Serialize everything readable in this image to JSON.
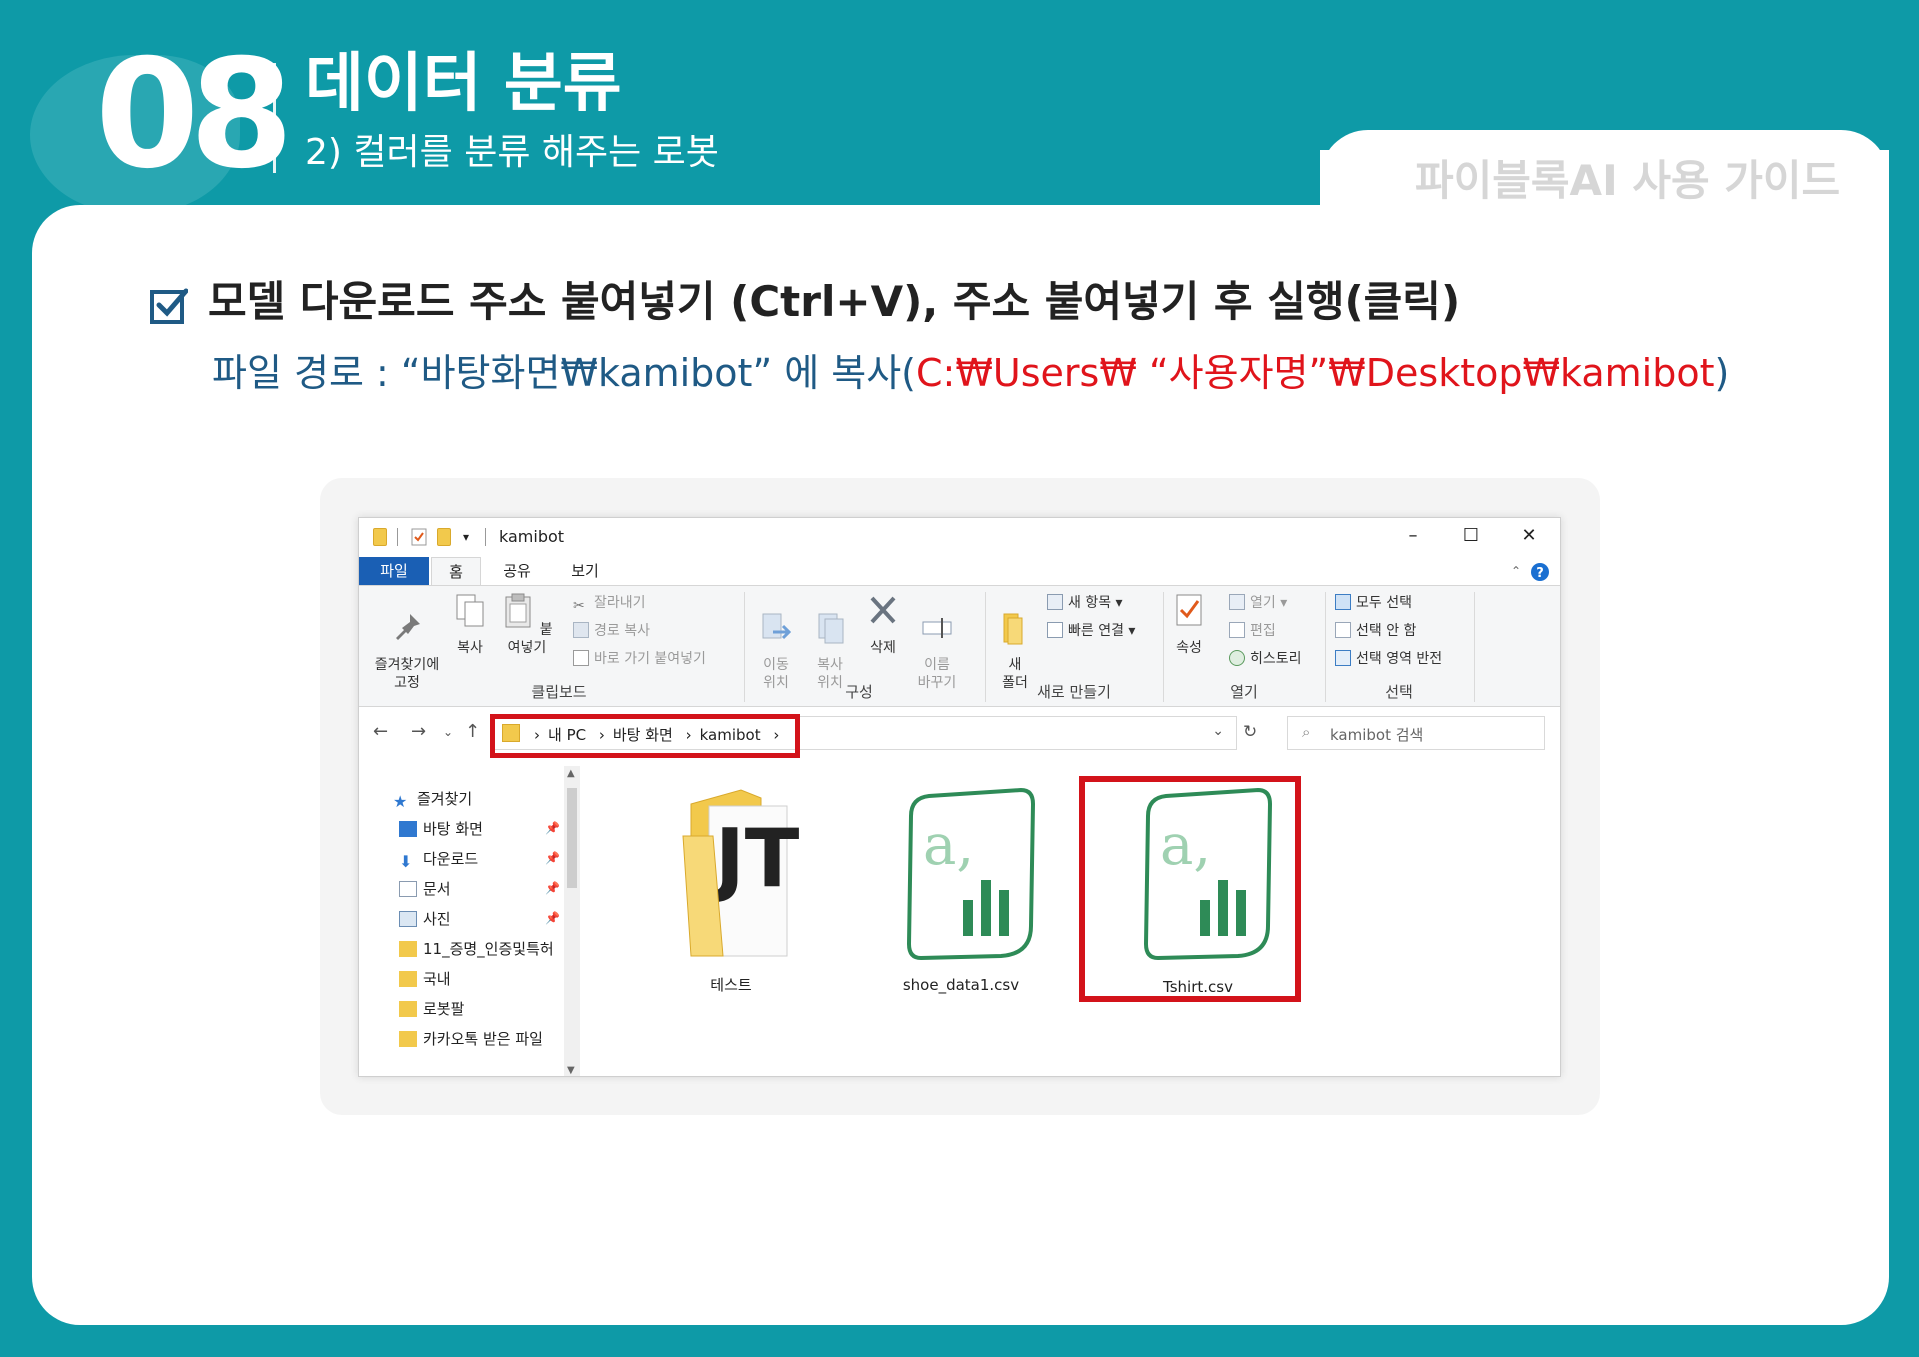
{
  "header": {
    "chapter_number": "08",
    "title": "데이터 분류",
    "subtitle": "2) 컬러를 분류 해주는 로봇",
    "guide_label": "파이블록AI 사용 가이드"
  },
  "instruction": {
    "title": "모델 다운로드 주소 붙여넣기 (Ctrl+V), 주소 붙여넣기 후 실행(클릭)",
    "path_prefix": "파일 경로 : “바탕화면₩kamibot” 에 복사(",
    "path_highlight": "C:₩Users₩ “사용자명”₩Desktop₩kamibot",
    "path_suffix": ")"
  },
  "explorer": {
    "window_title": "kamibot",
    "tabs": [
      "파일",
      "홈",
      "공유",
      "보기"
    ],
    "ribbon": {
      "pin_quick": "즐겨찾기에\n고정",
      "copy": "복사",
      "paste": "붙여넣기",
      "cut": "잘라내기",
      "copy_path": "경로 복사",
      "paste_shortcut": "바로 가기 붙여넣기",
      "clipboard_group": "클립보드",
      "move_to": "이동\n위치",
      "copy_to": "복사\n위치",
      "delete": "삭제",
      "rename": "이름\n바꾸기",
      "organize_group": "구성",
      "new_folder": "새\n폴더",
      "new_item": "새 항목",
      "easy_access": "빠른 연결",
      "new_group": "새로 만들기",
      "properties": "속성",
      "open": "열기",
      "edit": "편집",
      "history": "히스토리",
      "open_group": "열기",
      "select_all": "모두 선택",
      "select_none": "선택 안 함",
      "invert_selection": "선택 영역 반전",
      "select_group": "선택"
    },
    "breadcrumb": [
      "내 PC",
      "바탕 화면",
      "kamibot"
    ],
    "search_placeholder": "kamibot 검색",
    "nav": {
      "quick_access": "즐겨찾기",
      "items": [
        "바탕 화면",
        "다운로드",
        "문서",
        "사진",
        "11_증명_인증및특허",
        "국내",
        "로봇팔",
        "카카오톡 받은 파일"
      ]
    },
    "files": [
      {
        "name": "테스트",
        "type": "folder"
      },
      {
        "name": "shoe_data1.csv",
        "type": "csv"
      },
      {
        "name": "Tshirt.csv",
        "type": "csv"
      }
    ]
  }
}
